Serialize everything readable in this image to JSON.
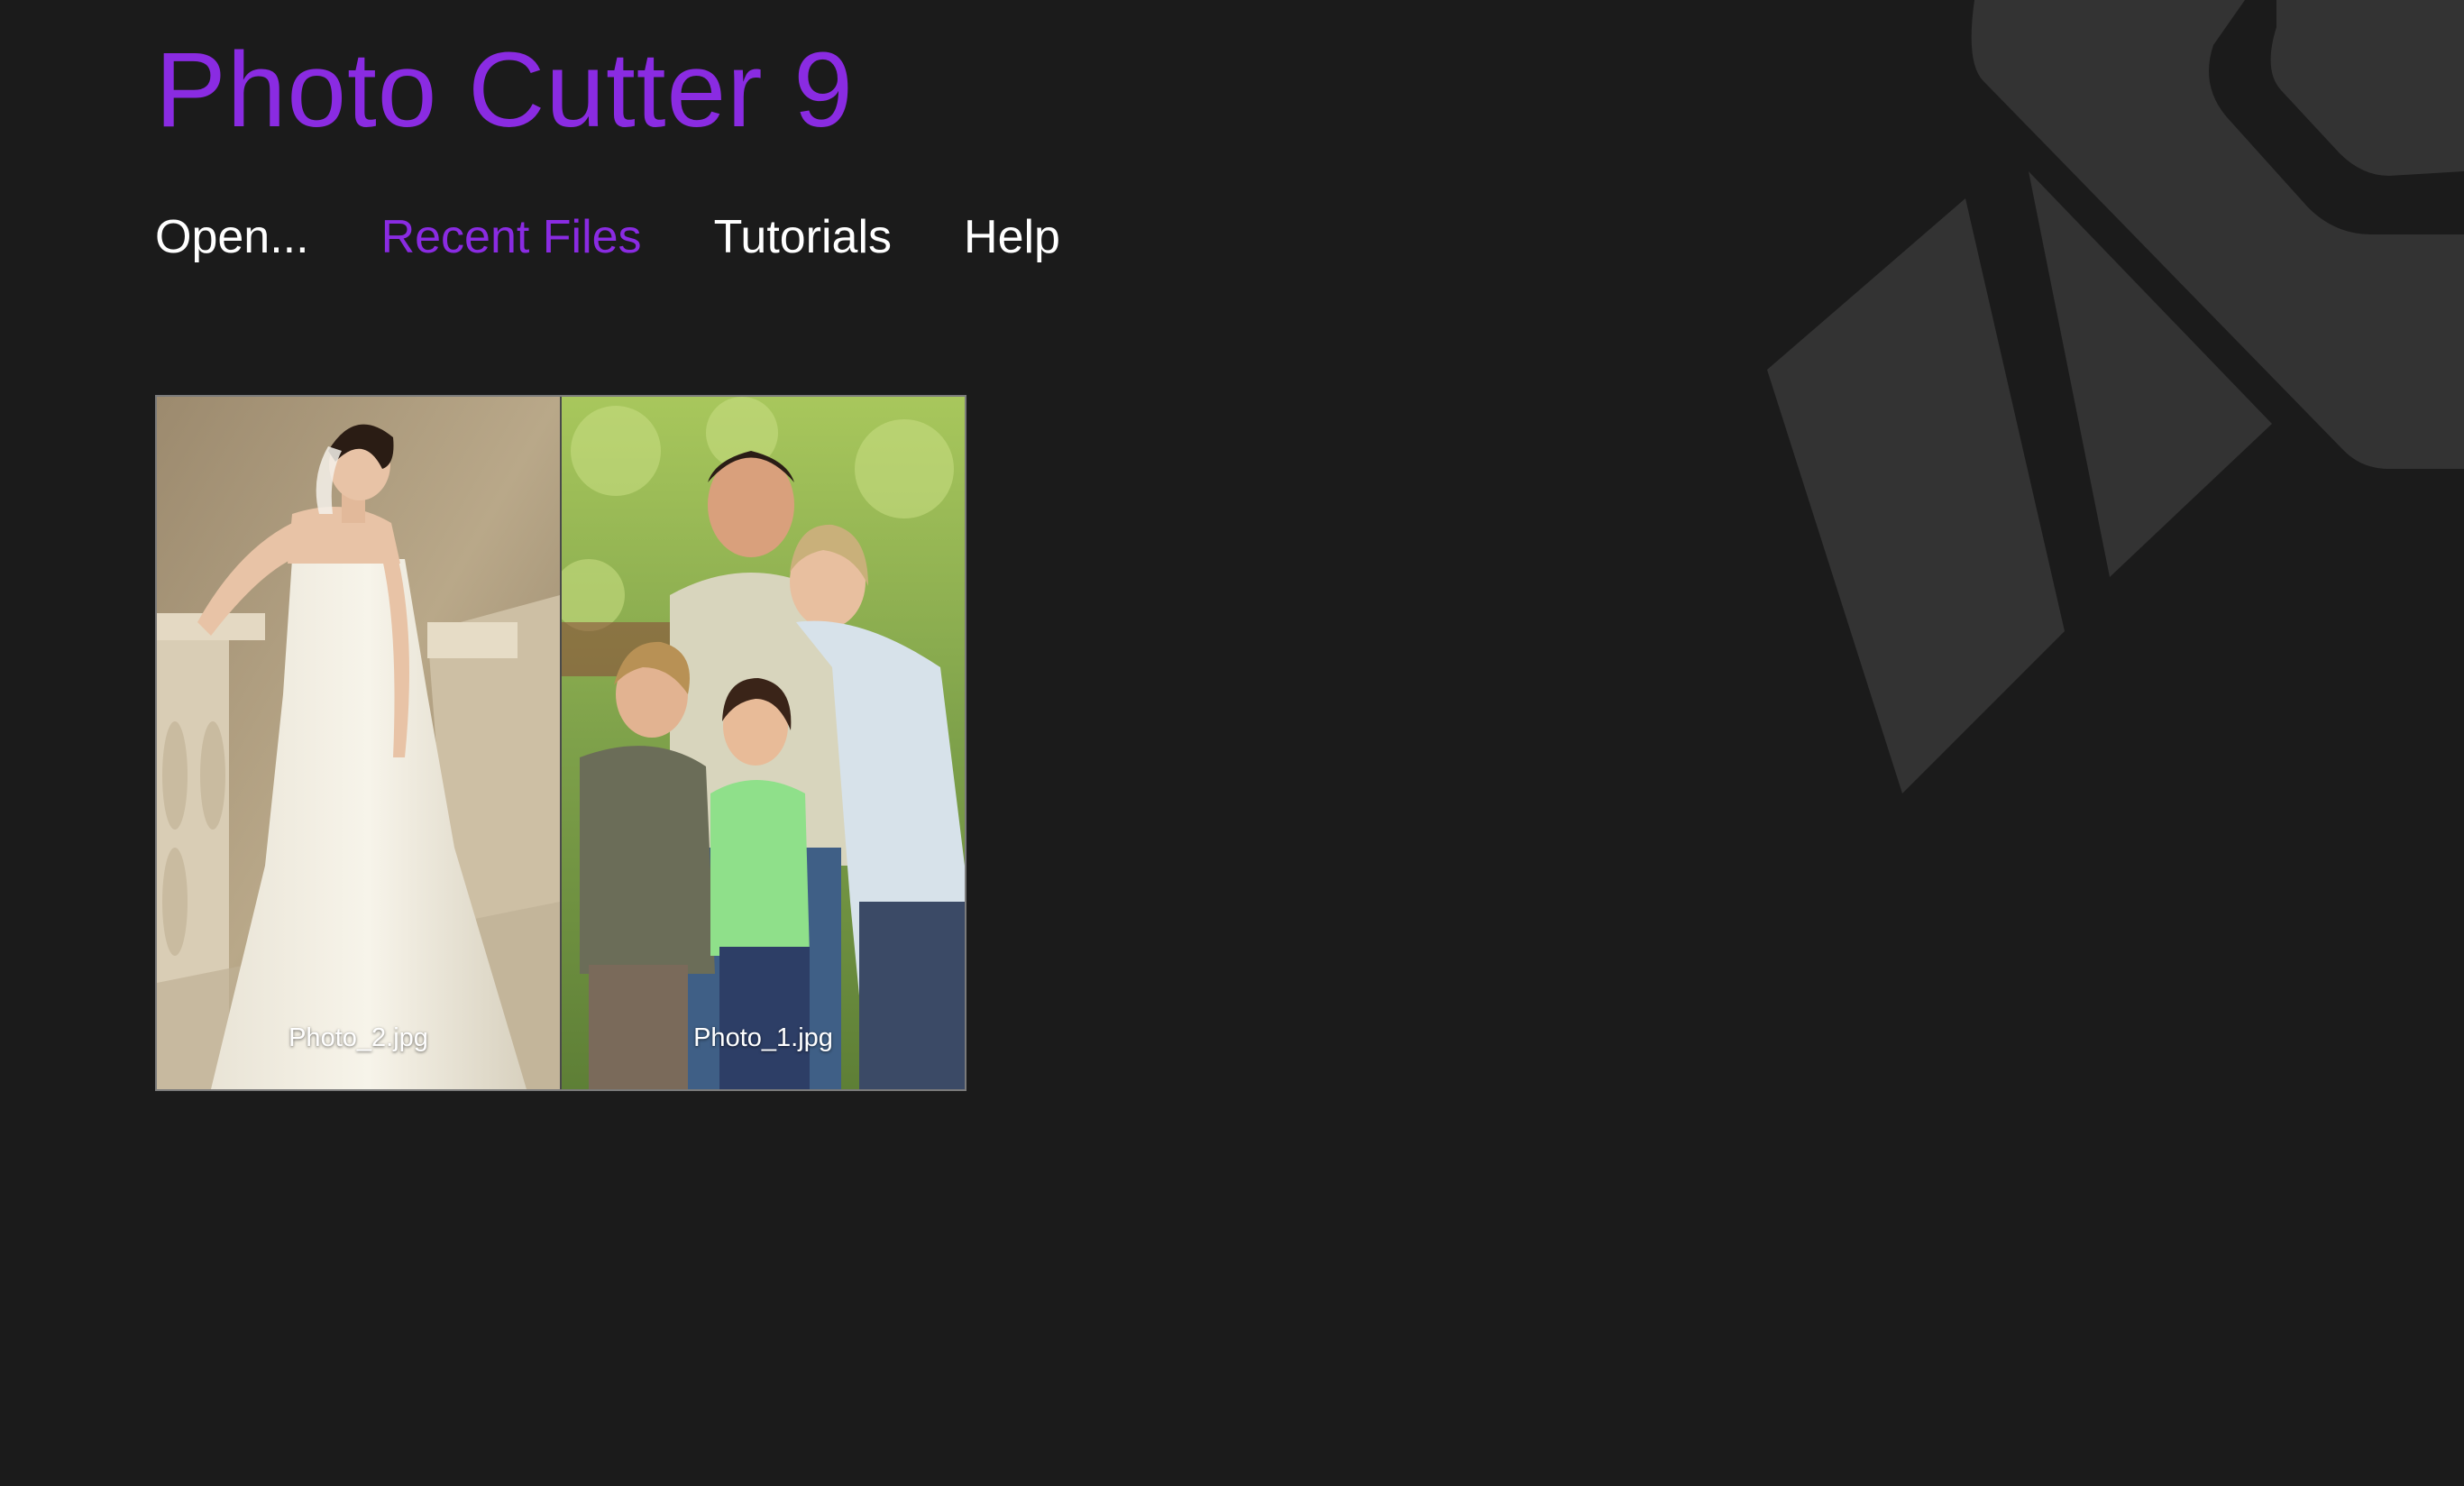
{
  "app": {
    "title": "Photo Cutter 9"
  },
  "nav": {
    "items": [
      {
        "label": "Open...",
        "active": false
      },
      {
        "label": "Recent Files",
        "active": true
      },
      {
        "label": "Tutorials",
        "active": false
      },
      {
        "label": "Help",
        "active": false
      }
    ]
  },
  "recent_files": [
    {
      "filename": "Photo_2.jpg",
      "thumbnail": "bride-in-white-dress-icon"
    },
    {
      "filename": "Photo_1.jpg",
      "thumbnail": "smiling-family-outdoors-icon"
    }
  ],
  "colors": {
    "background": "#1b1b1b",
    "accent": "#8a2be2",
    "text": "#ffffff",
    "watermark": "#3a3a3a"
  }
}
